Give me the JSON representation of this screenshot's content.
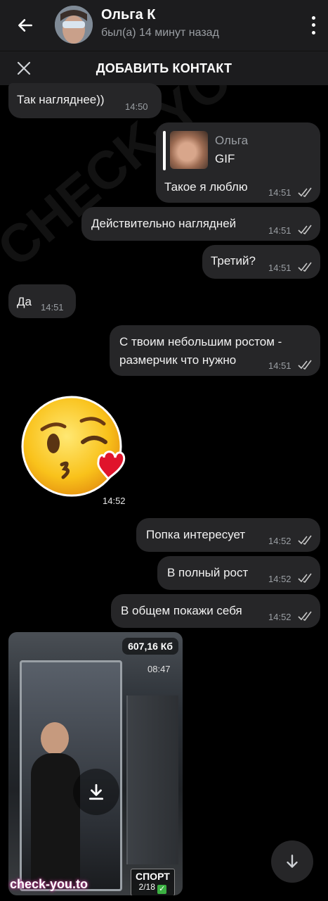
{
  "header": {
    "title": "Ольга К",
    "status": "был(а) 14 минут назад",
    "back_icon": "arrow-left-icon",
    "menu_icon": "kebab-menu-icon"
  },
  "add_contact_bar": {
    "label": "ДОБАВИТЬ КОНТАКТ",
    "close_icon": "close-icon"
  },
  "messages": [
    {
      "side": "in",
      "text": "Так нагляднее))",
      "time": "14:50"
    },
    {
      "side": "out",
      "reply_name": "Ольга",
      "reply_kind": "GIF",
      "text": "Такое я люблю",
      "time": "14:51"
    },
    {
      "side": "out",
      "text": "Действительно наглядней",
      "time": "14:51"
    },
    {
      "side": "out",
      "text": "Третий?",
      "time": "14:51"
    },
    {
      "side": "in",
      "text": "Да",
      "time": "14:51"
    },
    {
      "side": "out",
      "text_line1": "С твоим небольшим ростом -",
      "text_line2": "размерчик что нужно",
      "time": "14:51"
    },
    {
      "side": "in",
      "sticker": "kissing-wink-emoji",
      "time": "14:52"
    },
    {
      "side": "out",
      "text": "Попка интересует",
      "time": "14:52"
    },
    {
      "side": "out",
      "text": "В полный рост",
      "time": "14:52"
    },
    {
      "side": "out",
      "text": "В общем покажи себя",
      "time": "14:52"
    }
  ],
  "media_message": {
    "size": "607,16 Кб",
    "photo_clock": "08:47",
    "sign_line1": "СПОРТ",
    "sign_line2": "2/18",
    "download_icon": "download-icon"
  },
  "watermarks": {
    "diagonal": "CHECK-YOU.ME",
    "corner": "check-you.to"
  },
  "scroll_down_icon": "chevron-down-icon",
  "colors": {
    "background": "#000000",
    "header": "#1c1c1e",
    "bubble": "#262628",
    "time_text": "#9a9ea3"
  }
}
